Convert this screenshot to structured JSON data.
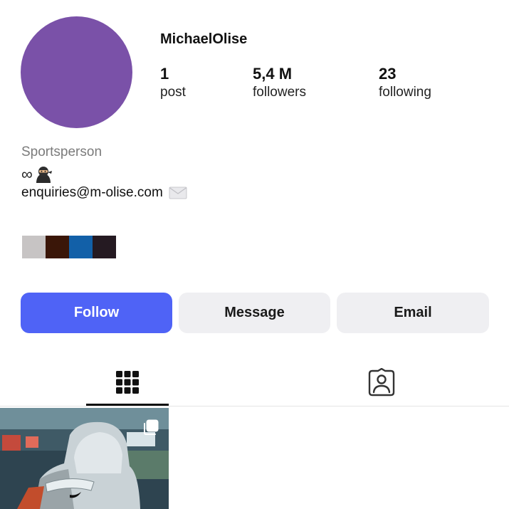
{
  "profile": {
    "username": "MichaelOlise",
    "avatar_color": "#7a51a8"
  },
  "stats": {
    "posts": {
      "value": "1",
      "label": "post"
    },
    "followers": {
      "value": "5,4 M",
      "label": "followers"
    },
    "following": {
      "value": "23",
      "label": "following"
    }
  },
  "bio": {
    "category": "Sportsperson",
    "line_symbol": "∞",
    "line_emoji": "ninja-emoji",
    "email": "enquiries@m-olise.com",
    "email_emoji": "envelope-emoji"
  },
  "swatches": [
    "#c7c4c4",
    "#3a1608",
    "#1260a8",
    "#251a22"
  ],
  "actions": {
    "follow": "Follow",
    "message": "Message",
    "email": "Email",
    "follow_color": "#4f63f6"
  },
  "tabs": [
    {
      "icon": "grid-icon",
      "active": true
    },
    {
      "icon": "tagged-icon",
      "active": false
    }
  ],
  "posts": [
    {
      "thumbnail": "hooded-player-photo",
      "multi_icon": "carousel-icon"
    }
  ]
}
